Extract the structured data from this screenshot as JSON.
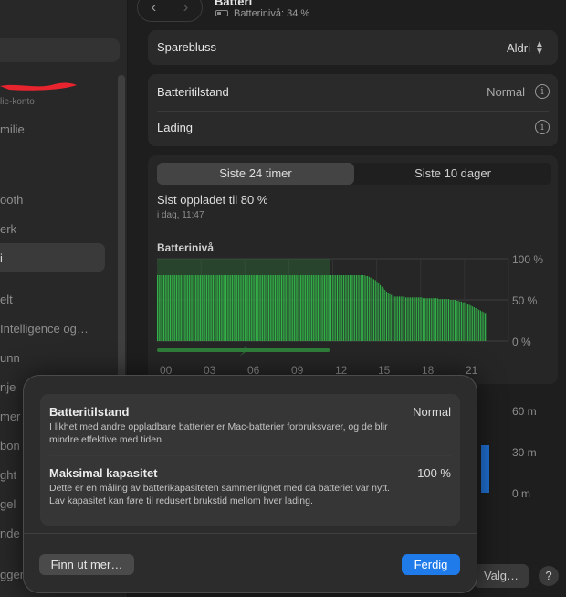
{
  "sidebar": {
    "items": [
      {
        "label": "lie-konto",
        "kind": "sub"
      },
      {
        "label": "milie"
      },
      {
        "label": "ooth"
      },
      {
        "label": "erk"
      },
      {
        "label": "i"
      },
      {
        "label": "elt"
      },
      {
        "label": "Intelligence og…"
      },
      {
        "label": "unn"
      },
      {
        "label": "nje"
      },
      {
        "label": "mer"
      },
      {
        "label": "bon"
      },
      {
        "label": "ght"
      },
      {
        "label": "gel"
      },
      {
        "label": "nde"
      },
      {
        "label": "gger"
      }
    ]
  },
  "header": {
    "title": "Batteri",
    "subtitle": "Batterinivå: 34 %"
  },
  "power_saver": {
    "label": "Sparebluss",
    "value": "Aldri"
  },
  "health": {
    "label": "Batteritilstand",
    "value": "Normal"
  },
  "charging": {
    "label": "Lading"
  },
  "tabs": [
    "Siste 24 timer",
    "Siste 10 dager"
  ],
  "last_charged": {
    "text": "Sist oppladet til 80 %",
    "time": "i dag, 11:47"
  },
  "chart_data": {
    "type": "bar",
    "title": "Batterinivå",
    "yticks": [
      "100 %",
      "50 %",
      "0 %"
    ],
    "xticks": [
      "00",
      "03",
      "06",
      "09",
      "12",
      "15",
      "18",
      "21"
    ],
    "ylim": [
      0,
      100
    ],
    "bar_color": "#33b249",
    "charging_color": "#2f7d3a",
    "values": [
      80,
      80,
      80,
      80,
      80,
      80,
      80,
      80,
      80,
      80,
      80,
      80,
      80,
      80,
      80,
      80,
      80,
      80,
      80,
      80,
      80,
      80,
      80,
      80,
      80,
      80,
      80,
      80,
      80,
      80,
      80,
      80,
      80,
      80,
      80,
      80,
      80,
      80,
      80,
      80,
      80,
      80,
      80,
      80,
      80,
      80,
      80,
      80,
      80,
      80,
      80,
      80,
      80,
      80,
      80,
      80,
      80,
      80,
      80,
      80,
      80,
      80,
      80,
      80,
      80,
      80,
      80,
      80,
      80,
      80,
      80,
      80,
      80,
      80,
      80,
      80,
      80,
      80,
      80,
      80,
      80,
      80,
      80,
      80,
      80,
      80,
      80,
      80,
      80,
      80,
      80,
      80,
      80,
      80,
      80,
      80,
      80,
      80,
      80,
      80,
      80,
      80,
      80,
      80,
      80,
      80,
      80,
      80,
      80,
      80,
      80,
      80,
      80,
      80,
      80,
      80,
      80,
      80,
      80,
      80,
      80,
      80,
      80,
      80,
      80,
      80,
      80,
      80,
      80,
      80,
      80,
      79,
      79,
      78,
      77,
      76,
      75,
      74,
      72,
      70,
      68,
      66,
      64,
      62,
      60,
      58,
      57,
      56,
      55,
      54,
      54,
      54,
      54,
      54,
      54,
      54,
      53,
      53,
      53,
      53,
      53,
      53,
      53,
      53,
      53,
      53,
      53,
      52,
      52,
      52,
      52,
      52,
      52,
      52,
      52,
      52,
      52,
      51,
      51,
      51,
      51,
      51,
      51,
      51,
      50,
      50,
      50,
      50,
      49,
      49,
      48,
      48,
      47,
      47,
      46,
      45,
      44,
      43,
      42,
      41,
      40,
      39,
      38,
      37,
      36,
      35,
      34,
      34
    ],
    "charging_until_hour": 11.8
  },
  "usage_yticks": [
    "60 m",
    "30 m",
    "0 m"
  ],
  "dialog": {
    "health_title": "Batteritilstand",
    "health_value": "Normal",
    "health_desc": "I likhet med andre oppladbare batterier er Mac-batterier forbruksvarer, og de blir mindre effektive med tiden.",
    "capacity_title": "Maksimal kapasitet",
    "capacity_value": "100 %",
    "capacity_desc": "Dette er en måling av batterikapasiteten sammenlignet med da batteriet var nytt. Lav kapasitet kan føre til redusert brukstid mellom hver lading.",
    "learn_more": "Finn ut mer…",
    "done": "Ferdig"
  },
  "footer": {
    "options": "Valg…",
    "help": "?"
  }
}
